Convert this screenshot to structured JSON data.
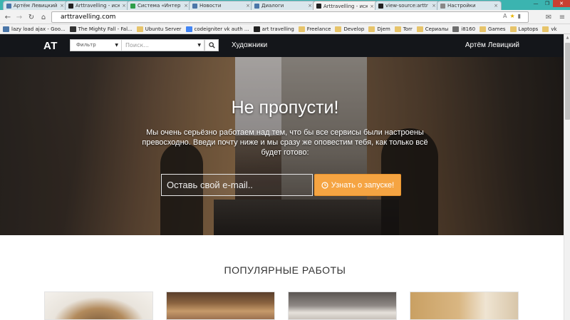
{
  "browser": {
    "tabs": [
      {
        "title": "Артём Левицкий",
        "icon": "vk",
        "color": "#4a76a8",
        "active": false
      },
      {
        "title": "Arttravelling - иск",
        "icon": "art",
        "color": "#222222",
        "active": false
      },
      {
        "title": "Система «Интер",
        "icon": "sys",
        "color": "#2e9e4a",
        "active": false
      },
      {
        "title": "Новости",
        "icon": "vk",
        "color": "#4a76a8",
        "active": false
      },
      {
        "title": "Диалоги",
        "icon": "vk-msg",
        "color": "#4a76a8",
        "active": false
      },
      {
        "title": "Arttravelling - иск",
        "icon": "art",
        "color": "#222222",
        "active": true
      },
      {
        "title": "view-source:arttr",
        "icon": "art",
        "color": "#222222",
        "active": false
      },
      {
        "title": "Настройки",
        "icon": "gear",
        "color": "#888888",
        "active": false
      }
    ],
    "url": "arttravelling.com",
    "bookmarks": [
      {
        "label": "lazy load ajax - Goo...",
        "type": "vk"
      },
      {
        "label": "The Mighty Fall - Fal...",
        "type": "media"
      },
      {
        "label": "Ubuntu Server",
        "type": "folder"
      },
      {
        "label": "codeigniter vk auth ...",
        "type": "google"
      },
      {
        "label": "art travelling",
        "type": "art"
      },
      {
        "label": "Freelance",
        "type": "folder"
      },
      {
        "label": "Develop",
        "type": "folder"
      },
      {
        "label": "Djem",
        "type": "folder"
      },
      {
        "label": "Torr",
        "type": "folder"
      },
      {
        "label": "Сериалы",
        "type": "folder"
      },
      {
        "label": "i8160",
        "type": "page"
      },
      {
        "label": "Games",
        "type": "folder"
      },
      {
        "label": "Laptops",
        "type": "folder"
      },
      {
        "label": "vk",
        "type": "folder"
      }
    ]
  },
  "site": {
    "logo": "AT",
    "filter_label": "Фильтр",
    "search_placeholder": "Поиск...",
    "nav_link": "Художники",
    "user_name": "Артём Левицкий"
  },
  "hero": {
    "title": "Не пропусти!",
    "text": "Мы очень серьёзно работаем над тем, что бы все сервисы были настроены превосходно. Введи почту ниже и мы сразу же оповестим тебя, как только всё будет готово:",
    "email_placeholder": "Оставь свой e-mail..",
    "button_label": "Узнать о запуске!"
  },
  "section": {
    "title": "ПОПУЛЯРНЫЕ РАБОТЫ"
  },
  "colors": {
    "accent": "#f5a442",
    "navbar": "#14161a"
  }
}
